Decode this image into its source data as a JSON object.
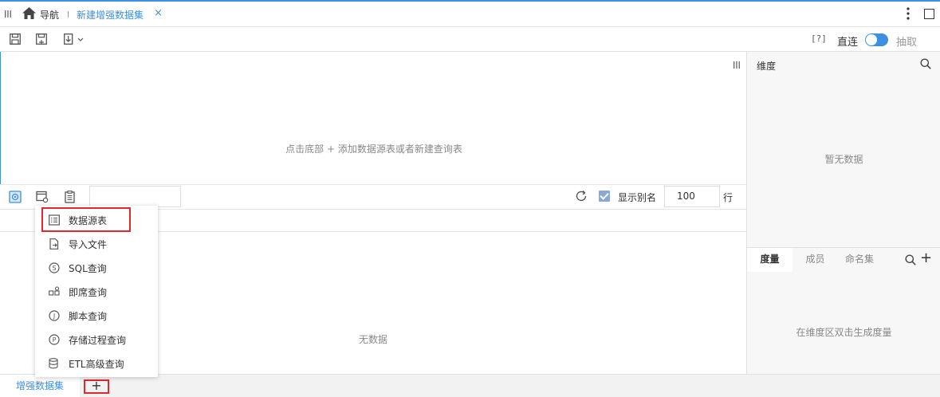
{
  "tabbar": {
    "nav_label": "导航",
    "active_tab": "新建增强数据集",
    "close_glyph": "×"
  },
  "toolbar": {
    "help": "[?]",
    "direct_label": "直连",
    "extract_label": "抽取",
    "direct_mode_on": true
  },
  "canvas": {
    "hint": "点击底部 + 添加数据源表或者新建查询表"
  },
  "preview_toolbar": {
    "show_alias_label": "显示别名",
    "show_alias_checked": true,
    "rows_value": "100",
    "rows_label": "行"
  },
  "preview": {
    "empty": "无数据"
  },
  "right_pane": {
    "dimension_title": "维度",
    "dimension_empty": "暂无数据",
    "tabs": [
      {
        "label": "度量",
        "active": true
      },
      {
        "label": "成员",
        "active": false
      },
      {
        "label": "命名集",
        "active": false
      }
    ],
    "add_glyph": "+",
    "measure_empty": "在维度区双击生成度量"
  },
  "menu": {
    "items": [
      {
        "label": "数据源表",
        "icon": "table-list-icon"
      },
      {
        "label": "导入文件",
        "icon": "import-file-icon"
      },
      {
        "label": "SQL查询",
        "icon": "sql-query-icon"
      },
      {
        "label": "即席查询",
        "icon": "adhoc-query-icon"
      },
      {
        "label": "脚本查询",
        "icon": "script-query-icon"
      },
      {
        "label": "存储过程查询",
        "icon": "stored-procedure-icon"
      },
      {
        "label": "ETL高级查询",
        "icon": "etl-query-icon"
      }
    ]
  },
  "bottom": {
    "tab_label": "增强数据集",
    "add_glyph": "+"
  },
  "colors": {
    "accent": "#3d8fe0",
    "highlight_border": "#e0282e",
    "muted_text": "#888888"
  }
}
